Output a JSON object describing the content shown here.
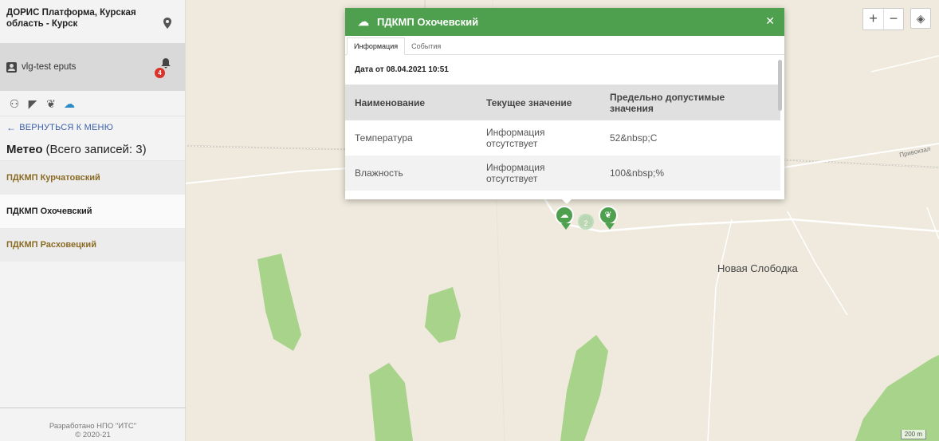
{
  "sidebar": {
    "title": "ДОРИС Платформа, Курская область - Курск",
    "user": "vlg-test eputs",
    "notification_count": "4",
    "back_label": "ВЕРНУТЬСЯ К МЕНЮ",
    "section_title": "Метео",
    "section_count": "(Всего записей: 3)",
    "items": [
      {
        "label": "ПДКМП Курчатовский"
      },
      {
        "label": "ПДКМП Охочевский"
      },
      {
        "label": "ПДКМП Расховецкий"
      }
    ],
    "footer_line1": "Разработано НПО \"ИТС\"",
    "footer_line2": "© 2020-21"
  },
  "popup": {
    "title": "ПДКМП Охочевский",
    "tabs": [
      "Информация",
      "События"
    ],
    "date": "Дата от 08.04.2021 10:51",
    "columns": [
      "Наименование",
      "Текущее значение",
      "Предельно допустимые значения"
    ],
    "rows": [
      {
        "name": "Температура",
        "value": "Информация отсутствует",
        "limit": "52&nbsp;C"
      },
      {
        "name": "Влажность",
        "value": "Информация отсутствует",
        "limit": "100&nbsp;%"
      }
    ]
  },
  "map": {
    "place_label": "Новая Слободка",
    "road_label": "Привокзал",
    "scale": "200 m",
    "cluster_count": "2",
    "zoom_in": "+",
    "zoom_out": "−"
  },
  "colors": {
    "accent_green": "#4ea04e",
    "gold_text": "#8a6b25",
    "link_blue": "#3b5fa8",
    "badge_red": "#d9342b"
  }
}
